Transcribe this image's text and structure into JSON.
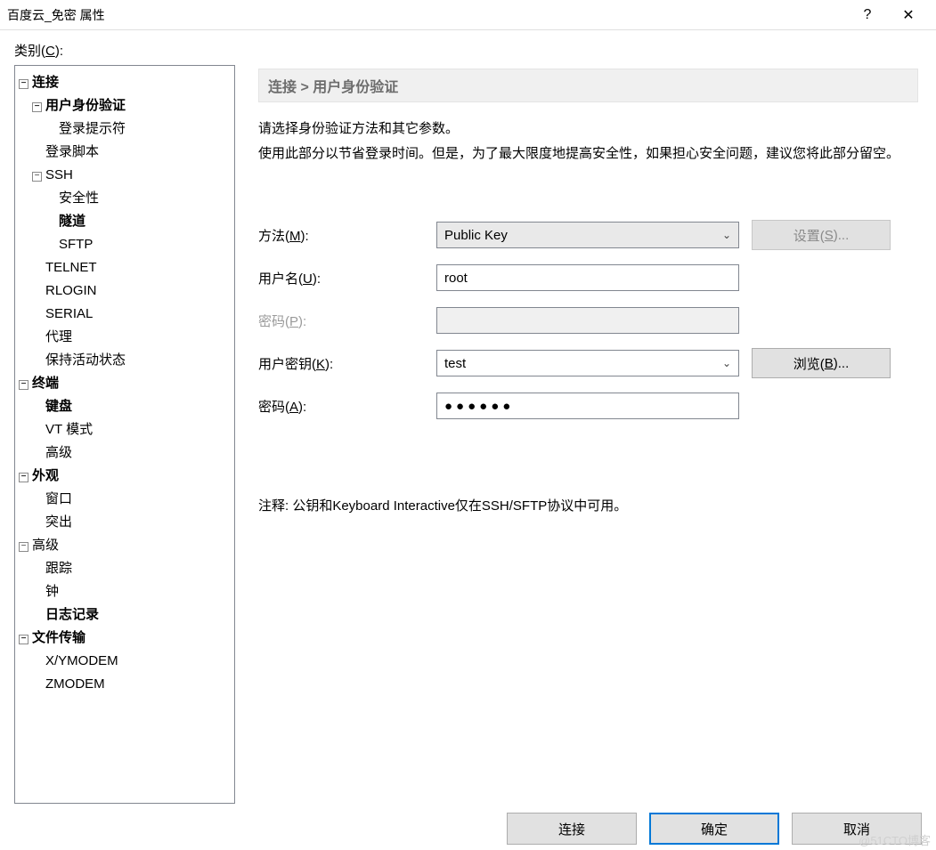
{
  "titlebar": {
    "title": "百度云_免密 属性",
    "help_symbol": "?",
    "close_symbol": "✕"
  },
  "category_label_prefix": "类别(",
  "category_label_hotkey": "C",
  "category_label_suffix": "):",
  "tree": {
    "toggle_minus": "−",
    "connection": "连接",
    "user_auth": "用户身份验证",
    "login_prompt": "登录提示符",
    "login_script": "登录脚本",
    "ssh": "SSH",
    "security": "安全性",
    "tunnel": "隧道",
    "sftp": "SFTP",
    "telnet": "TELNET",
    "rlogin": "RLOGIN",
    "serial": "SERIAL",
    "proxy": "代理",
    "keep_alive": "保持活动状态",
    "terminal": "终端",
    "keyboard": "键盘",
    "vt_mode": "VT 模式",
    "advanced_term": "高级",
    "appearance": "外观",
    "window": "窗口",
    "blink": "突出",
    "advanced": "高级",
    "trace": "跟踪",
    "bell": "钟",
    "logging": "日志记录",
    "file_transfer": "文件传输",
    "xymodem": "X/YMODEM",
    "zmodem": "ZMODEM"
  },
  "breadcrumb": "连接 > 用户身份验证",
  "description_line1": "请选择身份验证方法和其它参数。",
  "description_line2": "使用此部分以节省登录时间。但是，为了最大限度地提高安全性，如果担心安全问题，建议您将此部分留空。",
  "form": {
    "method_label": "方法(",
    "method_hotkey": "M",
    "method_suffix": "):",
    "method_value": "Public Key",
    "settings_btn": "设置(",
    "settings_hotkey": "S",
    "settings_suffix": ")...",
    "username_label": "用户名(",
    "username_hotkey": "U",
    "username_suffix": "):",
    "username_value": "root",
    "password_label": "密码(",
    "password_hotkey": "P",
    "password_suffix": "):",
    "userkey_label": "用户密钥(",
    "userkey_hotkey": "K",
    "userkey_suffix": "):",
    "userkey_value": "test",
    "browse_btn": "浏览(",
    "browse_hotkey": "B",
    "browse_suffix": ")...",
    "passphrase_label": "密码(",
    "passphrase_hotkey": "A",
    "passphrase_suffix": "):",
    "passphrase_value": "●●●●●●"
  },
  "note_text": "注释: 公钥和Keyboard Interactive仅在SSH/SFTP协议中可用。",
  "footer": {
    "connect": "连接",
    "ok": "确定",
    "cancel": "取消"
  },
  "watermark": "@51CTO博客"
}
